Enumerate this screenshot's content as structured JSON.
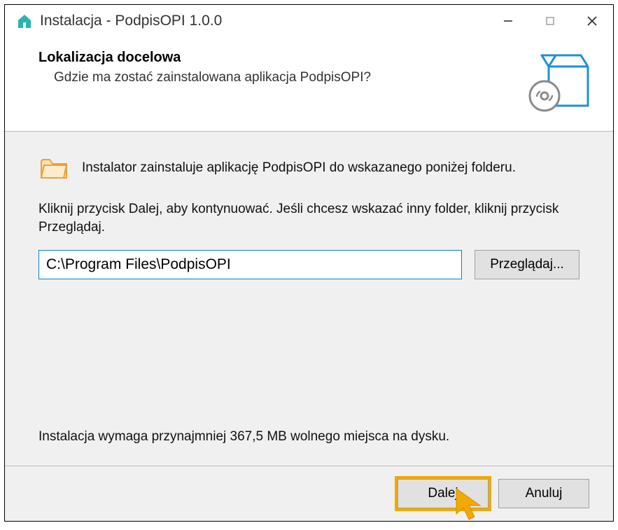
{
  "titlebar": {
    "title": "Instalacja - PodpisOPI 1.0.0"
  },
  "header": {
    "title": "Lokalizacja docelowa",
    "subtitle": "Gdzie ma zostać zainstalowana aplikacja PodpisOPI?"
  },
  "body": {
    "intro": "Instalator zainstaluje aplikację PodpisOPI do wskazanego poniżej folderu.",
    "instruction": "Kliknij przycisk Dalej, aby kontynuować. Jeśli chcesz wskazać inny folder, kliknij przycisk Przeglądaj.",
    "path_value": "C:\\Program Files\\PodpisOPI",
    "browse_label": "Przeglądaj...",
    "disk_space": "Instalacja wymaga przynajmniej 367,5 MB wolnego miejsca na dysku."
  },
  "footer": {
    "next_label": "Dalej",
    "cancel_label": "Anuluj"
  },
  "colors": {
    "accent": "#0a7dd6",
    "highlight": "#f2a900",
    "icon_teal": "#2ab3b3",
    "icon_blue": "#1e90d6",
    "folder_fill": "#f8e3b3",
    "folder_stroke": "#e9a23a"
  }
}
